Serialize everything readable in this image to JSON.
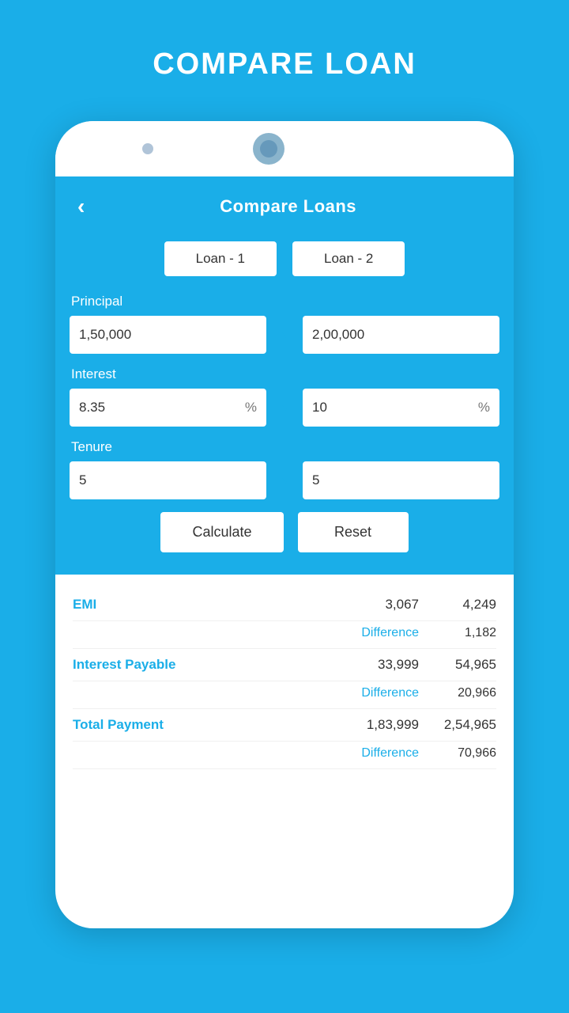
{
  "pageTitle": "COMPARE LOAN",
  "header": {
    "backIcon": "‹",
    "title": "Compare Loans"
  },
  "tabs": [
    {
      "label": "Loan - 1"
    },
    {
      "label": "Loan - 2"
    }
  ],
  "fields": {
    "principal": {
      "label": "Principal",
      "value1": "1,50,000",
      "value2": "2,00,000"
    },
    "interest": {
      "label": "Interest",
      "value1": "8.35",
      "suffix1": "%",
      "value2": "10",
      "suffix2": "%"
    },
    "tenure": {
      "label": "Tenure",
      "value1": "5",
      "value2": "5"
    }
  },
  "buttons": {
    "calculate": "Calculate",
    "reset": "Reset"
  },
  "results": {
    "emi": {
      "label": "EMI",
      "val1": "3,067",
      "val2": "4,249",
      "diff_label": "Difference",
      "diff_val": "1,182"
    },
    "interestPayable": {
      "label": "Interest Payable",
      "val1": "33,999",
      "val2": "54,965",
      "diff_label": "Difference",
      "diff_val": "20,966"
    },
    "totalPayment": {
      "label": "Total Payment",
      "val1": "1,83,999",
      "val2": "2,54,965",
      "diff_label": "Difference",
      "diff_val": "70,966"
    }
  },
  "arrowIcon": "›"
}
